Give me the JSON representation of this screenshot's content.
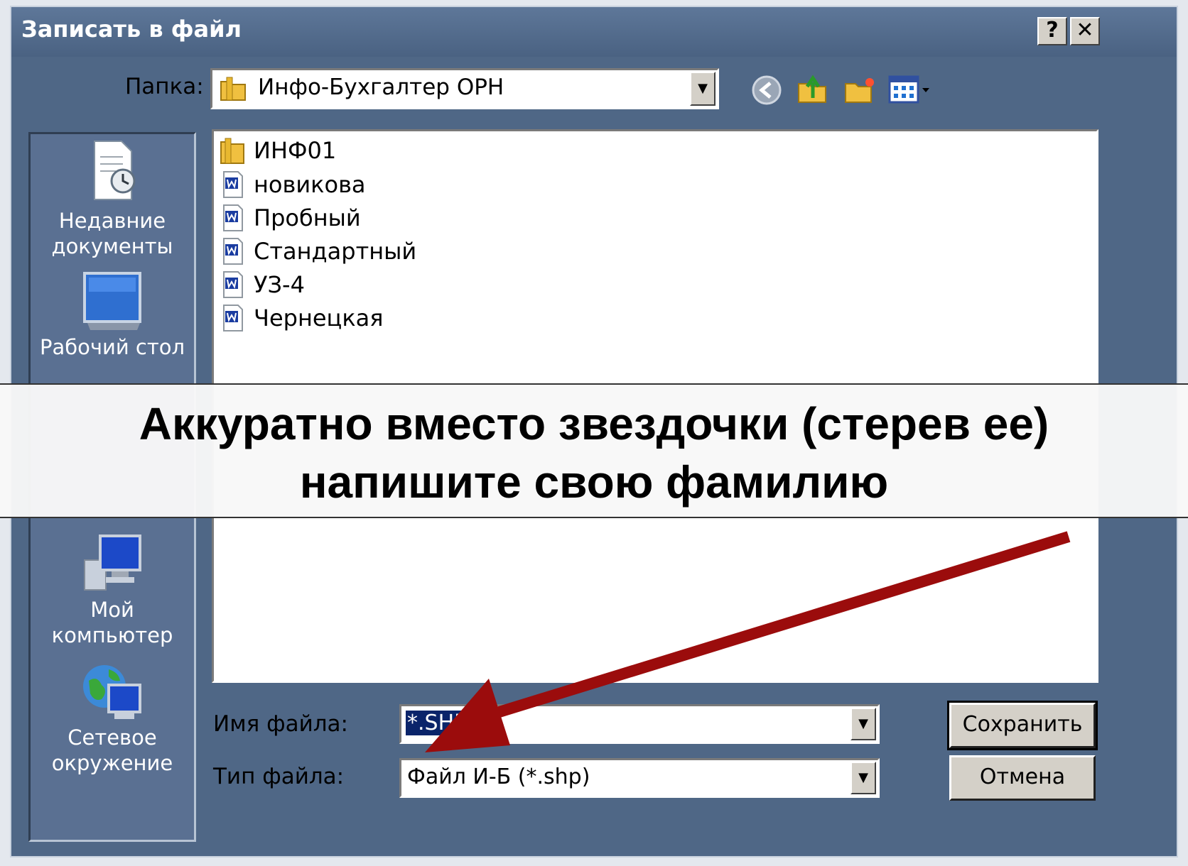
{
  "dialog": {
    "title": "Записать в файл",
    "help_button": "?",
    "close_button": "✕"
  },
  "folder": {
    "label": "Папка:",
    "value": "Инфо-Бухгалтер ОРН"
  },
  "places": [
    {
      "label_line1": "Недавние",
      "label_line2": "документы",
      "icon": "recent-documents-icon"
    },
    {
      "label_line1": "Рабочий стол",
      "label_line2": "",
      "icon": "desktop-icon"
    },
    {
      "label_line1": "Мой",
      "label_line2": "компьютер",
      "icon": "my-computer-icon"
    },
    {
      "label_line1": "Сетевое",
      "label_line2": "окружение",
      "icon": "network-icon"
    }
  ],
  "files": [
    {
      "name": "ИНФ01",
      "icon": "folder-icon"
    },
    {
      "name": "новикова",
      "icon": "document-icon"
    },
    {
      "name": "Пробный",
      "icon": "document-icon"
    },
    {
      "name": "Стандартный",
      "icon": "document-icon"
    },
    {
      "name": "УЗ-4",
      "icon": "document-icon"
    },
    {
      "name": "Чернецкая",
      "icon": "document-icon"
    }
  ],
  "filename": {
    "label": "Имя файла:",
    "value": "*.SHP"
  },
  "filetype": {
    "label": "Тип файла:",
    "value": "Файл И-Б (*.shp)"
  },
  "buttons": {
    "save": "Сохранить",
    "cancel": "Отмена"
  },
  "overlay": {
    "line1": "Аккуратно вместо звездочки (стерев ее)",
    "line2": "напишите свою фамилию"
  },
  "colors": {
    "dialog_bg": "#4f6786",
    "arrow": "#9b0c0c",
    "selection": "#0a246a"
  }
}
